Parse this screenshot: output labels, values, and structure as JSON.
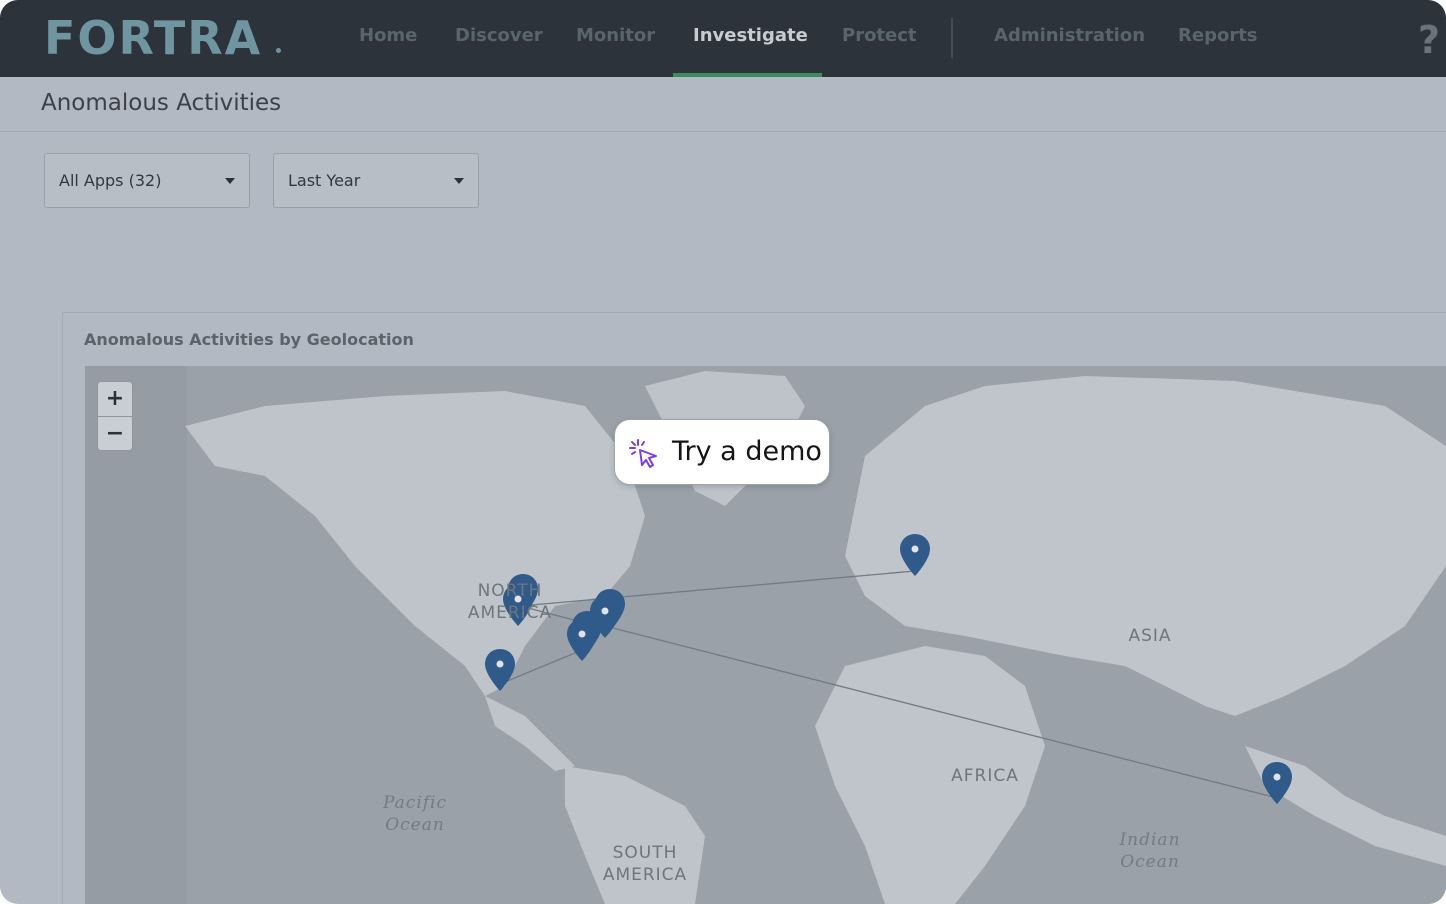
{
  "brand": {
    "name": "FORTRA"
  },
  "nav": {
    "items": [
      {
        "label": "Home"
      },
      {
        "label": "Discover"
      },
      {
        "label": "Monitor"
      },
      {
        "label": "Investigate",
        "active": true
      },
      {
        "label": "Protect"
      },
      {
        "label": "Administration"
      },
      {
        "label": "Reports"
      }
    ],
    "help_glyph": "?"
  },
  "page": {
    "title": "Anomalous Activities"
  },
  "filters": {
    "apps": {
      "value": "All Apps (32)"
    },
    "period": {
      "value": "Last Year"
    }
  },
  "panel": {
    "title": "Anomalous Activities by Geolocation",
    "zoom_in": "+",
    "zoom_out": "−",
    "labels": {
      "north_america_1": "NORTH",
      "north_america_2": "AMERICA",
      "asia": "ASIA",
      "africa": "AFRICA",
      "south_america_1": "SOUTH",
      "south_america_2": "AMERICA",
      "pacific_1": "Pacific",
      "pacific_2": "Ocean",
      "indian_1": "Indian",
      "indian_2": "Ocean"
    }
  },
  "demo": {
    "label": "Try a demo",
    "icon": "sparkle-cursor-icon",
    "accent": "#7b3fe4"
  },
  "colors": {
    "nav_bg": "#2c333b",
    "brand": "#6f95a1",
    "active_underline": "#3e8a5e",
    "marker": "#2f5a8a"
  }
}
